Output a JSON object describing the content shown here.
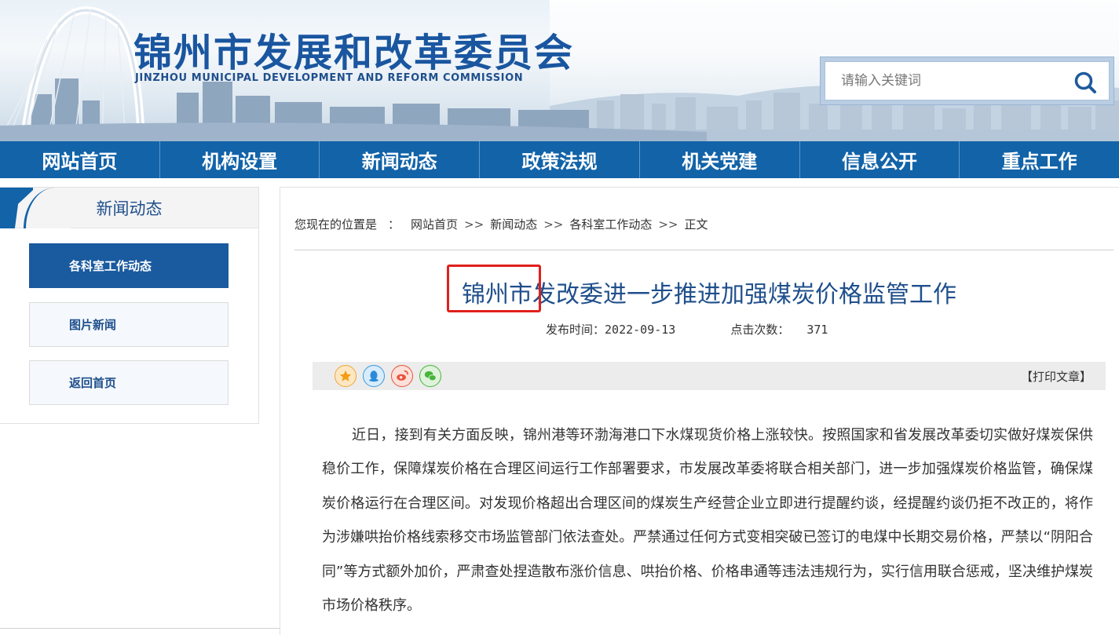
{
  "header": {
    "site_title": "锦州市发展和改革委员会",
    "site_subtitle": "JINZHOU MUNICIPAL DEVELOPMENT AND REFORM COMMISSION",
    "search_placeholder": "请输入关键词",
    "search_icon": "search-icon"
  },
  "nav": {
    "items": [
      {
        "label": "网站首页"
      },
      {
        "label": "机构设置"
      },
      {
        "label": "新闻动态"
      },
      {
        "label": "政策法规"
      },
      {
        "label": "机关党建"
      },
      {
        "label": "信息公开"
      },
      {
        "label": "重点工作"
      }
    ]
  },
  "sidebar": {
    "title": "新闻动态",
    "items": [
      {
        "label": "各科室工作动态",
        "active": true
      },
      {
        "label": "图片新闻",
        "active": false
      },
      {
        "label": "返回首页",
        "active": false
      }
    ]
  },
  "breadcrumb": {
    "prefix": "您现在的位置是",
    "colon": "：",
    "separator": ">>",
    "items": [
      "网站首页",
      "新闻动态",
      "各科室工作动态",
      "正文"
    ]
  },
  "article": {
    "title": "锦州市发改委进一步推进加强煤炭价格监管工作",
    "publish_label": "发布时间：",
    "publish_date": "2022-09-13",
    "views_label": "点击次数：",
    "views": "371",
    "print_label": "【打印文章】",
    "share_icons": [
      "favorite-icon",
      "qq-icon",
      "weibo-icon",
      "wechat-icon"
    ],
    "body": "近日，接到有关方面反映，锦州港等环渤海港口下水煤现货价格上涨较快。按照国家和省发展改革委切实做好煤炭保供稳价工作，保障煤炭价格在合理区间运行工作部署要求，市发展改革委将联合相关部门，进一步加强煤炭价格监管，确保煤炭价格运行在合理区间。对发现价格超出合理区间的煤炭生产经营企业立即进行提醒约谈，经提醒约谈仍拒不改正的，将作为涉嫌哄抬价格线索移交市场监管部门依法查处。严禁通过任何方式变相突破已签订的电煤中长期交易价格，严禁以“阴阳合同”等方式额外加价，严肃查处捏造散布涨价信息、哄抬价格、价格串通等违法违规行为，实行信用联合惩戒，坚决维护煤炭市场价格秩序。"
  },
  "colors": {
    "nav_blue": "#1263a8",
    "title_blue": "#1f4f8c",
    "highlight_red": "#e0201c"
  }
}
